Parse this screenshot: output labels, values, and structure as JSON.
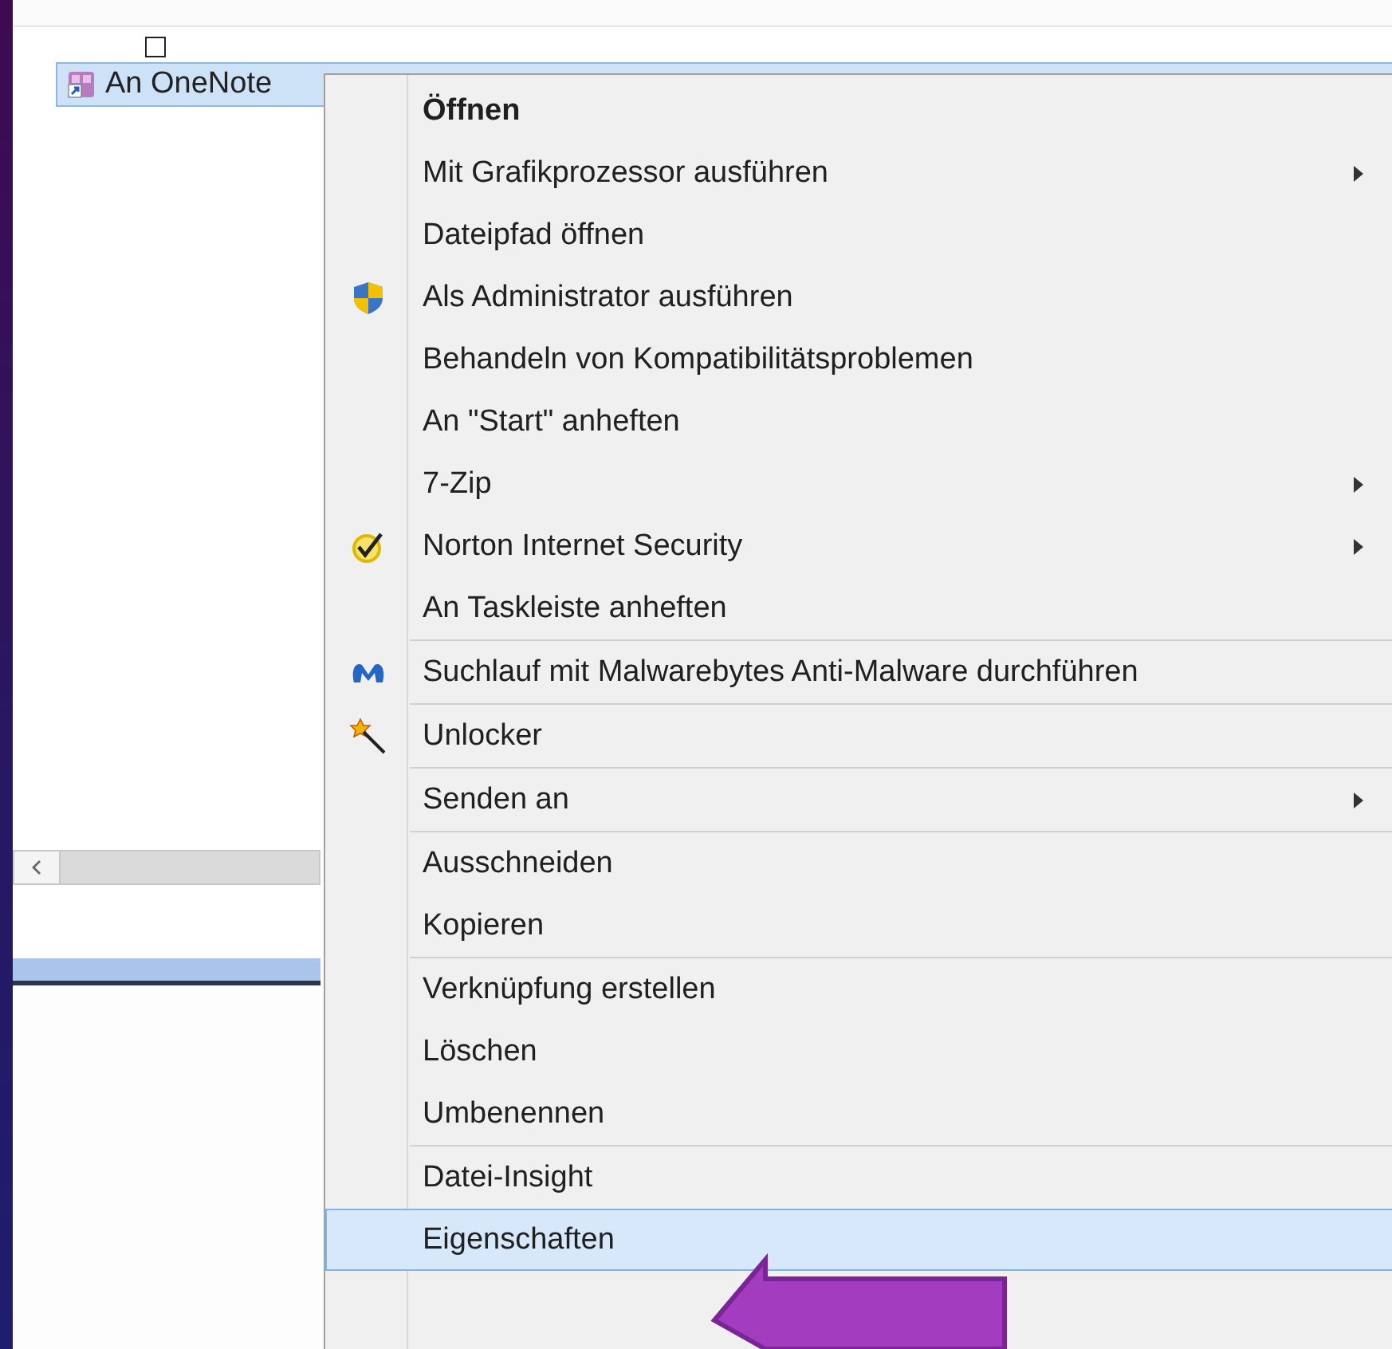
{
  "file_list": {
    "items": [
      {
        "name": "An OneNote",
        "selected": true,
        "checked": false
      }
    ]
  },
  "context_menu": {
    "items": [
      {
        "kind": "item",
        "label": "Öffnen",
        "default": true,
        "submenu": false,
        "selected": false
      },
      {
        "kind": "item",
        "label": "Mit Grafikprozessor ausführen",
        "default": false,
        "submenu": true,
        "selected": false
      },
      {
        "kind": "item",
        "label": "Dateipfad öffnen",
        "default": false,
        "submenu": false,
        "selected": false
      },
      {
        "kind": "item",
        "label": "Als Administrator ausführen",
        "default": false,
        "submenu": false,
        "selected": false
      },
      {
        "kind": "item",
        "label": "Behandeln von Kompatibilitätsproblemen",
        "default": false,
        "submenu": false,
        "selected": false
      },
      {
        "kind": "item",
        "label": "An \"Start\" anheften",
        "default": false,
        "submenu": false,
        "selected": false
      },
      {
        "kind": "item",
        "label": "7-Zip",
        "default": false,
        "submenu": true,
        "selected": false
      },
      {
        "kind": "item",
        "label": "Norton Internet Security",
        "default": false,
        "submenu": true,
        "selected": false
      },
      {
        "kind": "item",
        "label": "An Taskleiste anheften",
        "default": false,
        "submenu": false,
        "selected": false
      },
      {
        "kind": "separator"
      },
      {
        "kind": "item",
        "label": "Suchlauf mit Malwarebytes Anti-Malware durchführen",
        "default": false,
        "submenu": false,
        "selected": false
      },
      {
        "kind": "separator"
      },
      {
        "kind": "item",
        "label": "Unlocker",
        "default": false,
        "submenu": false,
        "selected": false
      },
      {
        "kind": "separator"
      },
      {
        "kind": "item",
        "label": "Senden an",
        "default": false,
        "submenu": true,
        "selected": false
      },
      {
        "kind": "separator"
      },
      {
        "kind": "item",
        "label": "Ausschneiden",
        "default": false,
        "submenu": false,
        "selected": false
      },
      {
        "kind": "item",
        "label": "Kopieren",
        "default": false,
        "submenu": false,
        "selected": false
      },
      {
        "kind": "separator"
      },
      {
        "kind": "item",
        "label": "Verknüpfung erstellen",
        "default": false,
        "submenu": false,
        "selected": false
      },
      {
        "kind": "item",
        "label": "Löschen",
        "default": false,
        "submenu": false,
        "selected": false
      },
      {
        "kind": "item",
        "label": "Umbenennen",
        "default": false,
        "submenu": false,
        "selected": false
      },
      {
        "kind": "separator"
      },
      {
        "kind": "item",
        "label": "Datei-Insight",
        "default": false,
        "submenu": false,
        "selected": false
      },
      {
        "kind": "item",
        "label": "Eigenschaften",
        "default": false,
        "submenu": false,
        "selected": true
      }
    ]
  }
}
